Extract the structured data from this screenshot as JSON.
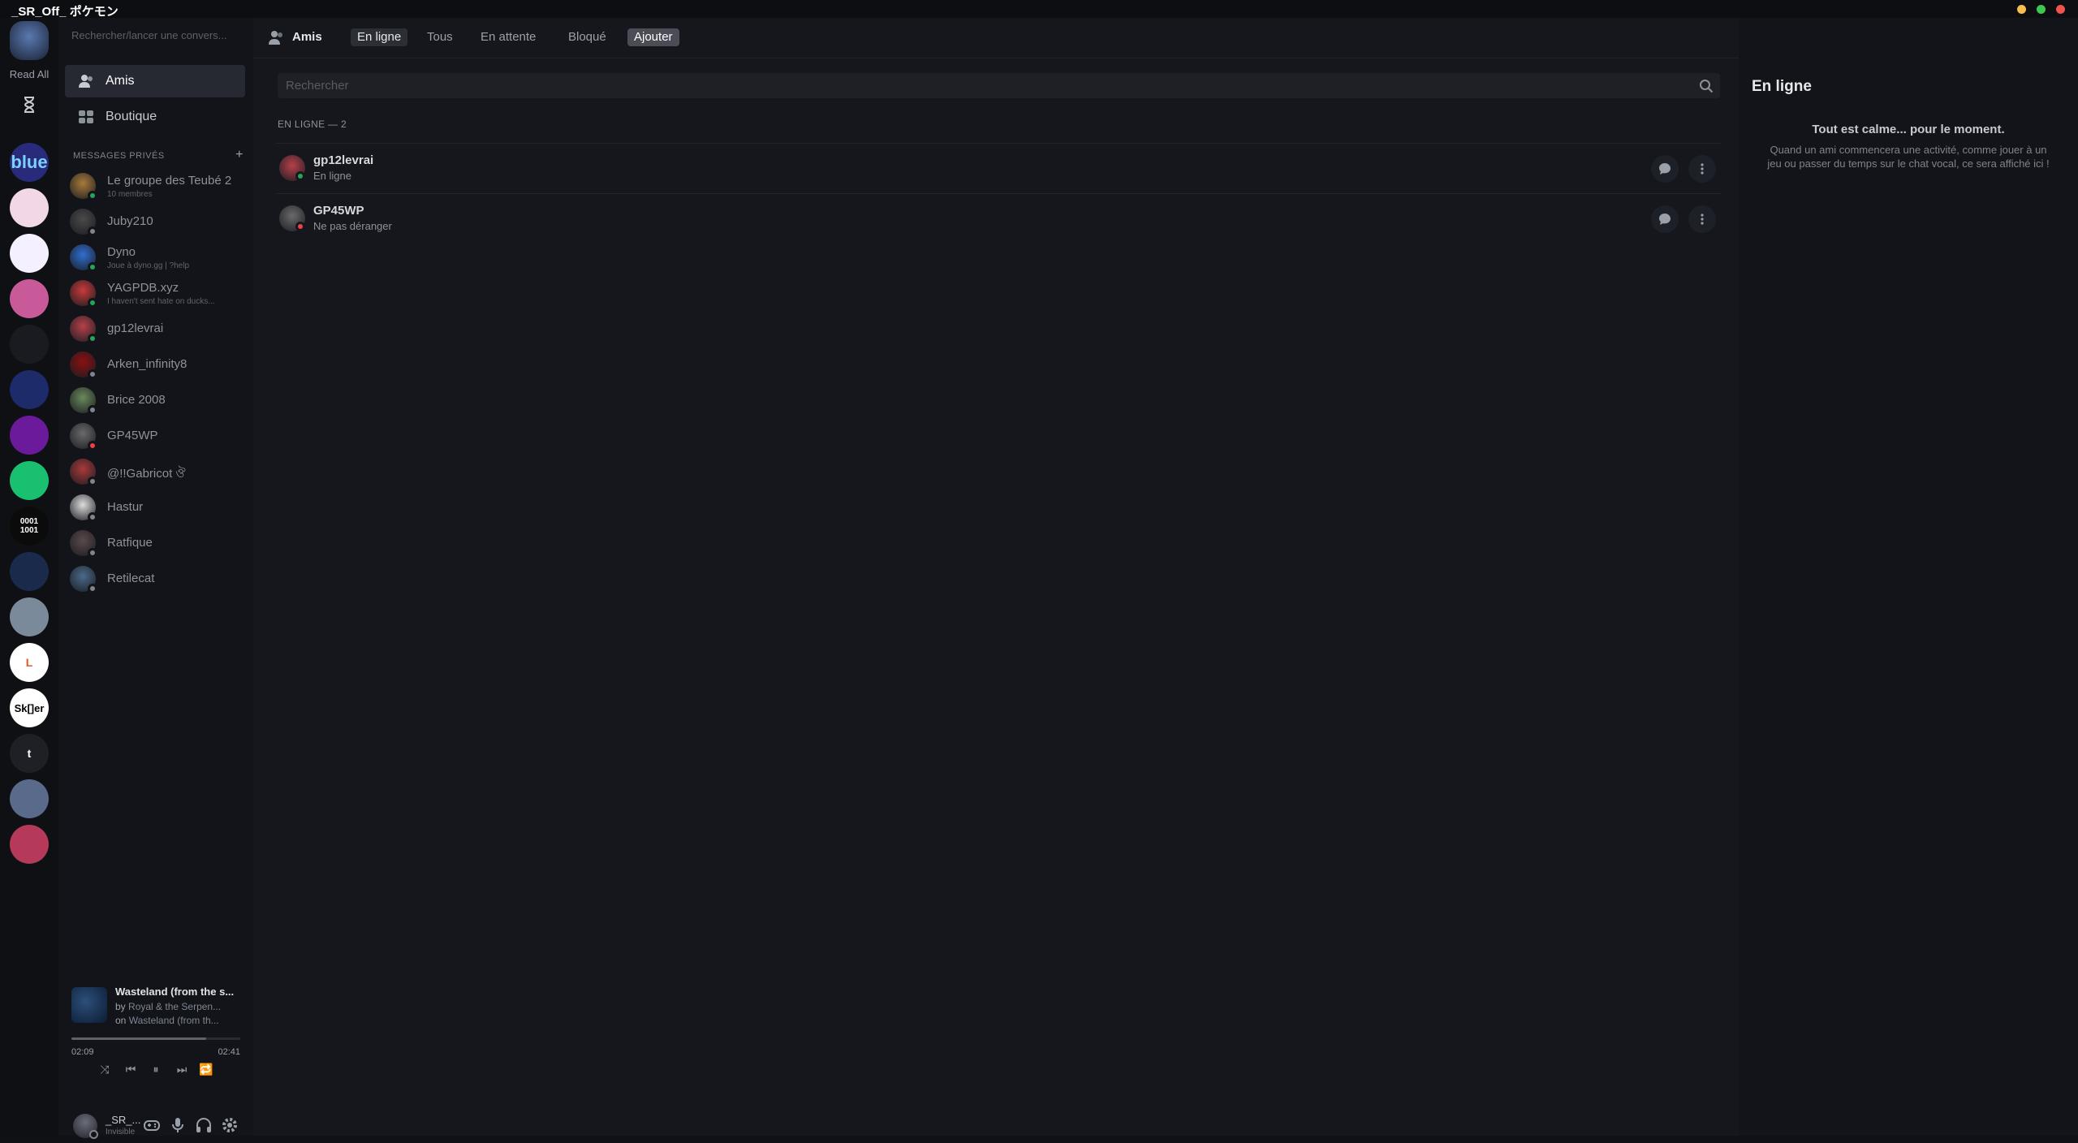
{
  "window": {
    "title": "_SR_Off_ ポケモン"
  },
  "rail": {
    "read_all": "Read All",
    "hourglass": "hourglass-icon",
    "servers": [
      {
        "label": "blue",
        "color": "#2a2a7a"
      },
      {
        "label": "",
        "color": "#f2d8e6"
      },
      {
        "label": "",
        "color": "#f5f0ff"
      },
      {
        "label": "",
        "color": "#c85a9a"
      },
      {
        "label": "",
        "color": "#1a1b20"
      },
      {
        "label": "",
        "color": "#1d2b6a"
      },
      {
        "label": "",
        "color": "#6a1a9a"
      },
      {
        "label": "",
        "color": "#18c070"
      },
      {
        "label": "0001 1001",
        "color": "#0b0b0b"
      },
      {
        "label": "",
        "color": "#1a2a4a"
      },
      {
        "label": "",
        "color": "#7a8a9a"
      },
      {
        "label": "L",
        "color": "#ffffff"
      },
      {
        "label": "Sk[]er",
        "color": "#ffffff"
      },
      {
        "label": "t",
        "color": "#1f2026"
      },
      {
        "label": "",
        "color": "#5a6a8a"
      },
      {
        "label": "",
        "color": "#b53a5a"
      }
    ]
  },
  "sidebar": {
    "search_placeholder": "Rechercher/lancer une convers...",
    "nav": [
      {
        "label": "Amis",
        "icon": "friends-icon"
      },
      {
        "label": "Boutique",
        "icon": "shop-icon"
      }
    ],
    "dm_header": "MESSAGES PRIVÉS",
    "dm_add": "+",
    "dms": [
      {
        "name": "Le groupe des Teubé 2",
        "sub": "10 membres",
        "status": "#23a55a",
        "avatar": "#a87a3a"
      },
      {
        "name": "Juby210",
        "sub": "",
        "status": "#80848e",
        "avatar": "#4a4a4a"
      },
      {
        "name": "Dyno",
        "sub": "Joue à dyno.gg | ?help",
        "status": "#23a55a",
        "avatar": "#2f6fd0"
      },
      {
        "name": "YAGPDB.xyz",
        "sub": "I haven't sent hate on ducks...",
        "status": "#23a55a",
        "avatar": "#c83a3a"
      },
      {
        "name": "gp12levrai",
        "sub": "",
        "status": "#23a55a",
        "avatar": "#b8404a"
      },
      {
        "name": "Arken_infinity8",
        "sub": "",
        "status": "#80848e",
        "avatar": "#8a1010"
      },
      {
        "name": "Brice 2008",
        "sub": "",
        "status": "#80848e",
        "avatar": "#6a8a5a"
      },
      {
        "name": "GP45WP",
        "sub": "",
        "status": "#f23f43",
        "avatar": "#6a6a6a"
      },
      {
        "name": "@!!Gabricot ঔ",
        "sub": "",
        "status": "#80848e",
        "avatar": "#aa3a3a"
      },
      {
        "name": "Hastur",
        "sub": "",
        "status": "#80848e",
        "avatar": "#dcdcdc"
      },
      {
        "name": "Ratfique",
        "sub": "",
        "status": "#80848e",
        "avatar": "#5a4a4a"
      },
      {
        "name": "Retilecat",
        "sub": "",
        "status": "#80848e",
        "avatar": "#4a6a8a"
      }
    ]
  },
  "player": {
    "title": "Wasteland (from the s...",
    "by_prefix": "by",
    "artist": "Royal & the Serpen...",
    "on_prefix": "on",
    "album": "Wasteland (from th...",
    "elapsed": "02:09",
    "total": "02:41",
    "progress": 0.8
  },
  "user": {
    "name": "_SR_...",
    "status": "Invisible"
  },
  "topbar": {
    "title": "Amis",
    "tabs": [
      "En ligne",
      "Tous",
      "En attente",
      "Bloqué",
      "Ajouter"
    ]
  },
  "friends": {
    "search_placeholder": "Rechercher",
    "header": "EN LIGNE — 2",
    "rows": [
      {
        "name": "gp12levrai",
        "status": "En ligne",
        "dot": "#23a55a",
        "avatar": "#b8404a"
      },
      {
        "name": "GP45WP",
        "status": "Ne pas déranger",
        "dot": "#f23f43",
        "avatar": "#6a6a6a"
      }
    ]
  },
  "right": {
    "title": "En ligne",
    "empty_title": "Tout est calme... pour le moment.",
    "empty_body": "Quand un ami commencera une activité, comme jouer à un jeu ou passer du temps sur le chat vocal, ce sera affiché ici !"
  }
}
